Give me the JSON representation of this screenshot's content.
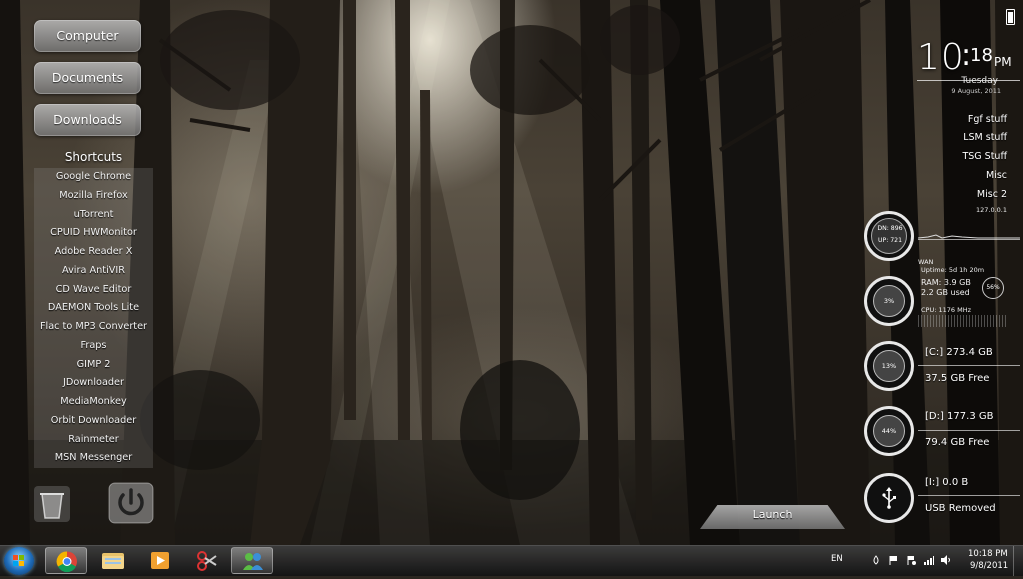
{
  "side_buttons": {
    "computer": "Computer",
    "documents": "Documents",
    "downloads": "Downloads"
  },
  "shortcuts": {
    "title": "Shortcuts",
    "items": [
      "Google Chrome",
      "Mozilla Firefox",
      "uTorrent",
      "CPUID HWMonitor",
      "Adobe Reader X",
      "Avira AntiVIR",
      "CD Wave Editor",
      "DAEMON Tools Lite",
      "Flac to MP3 Converter",
      "Fraps",
      "GIMP 2",
      "JDownloader",
      "MediaMonkey",
      "Orbit Downloader",
      "Rainmeter",
      "MSN Messenger"
    ]
  },
  "clock": {
    "hour": "10",
    "colon": ":",
    "minute": "18",
    "ampm": "PM",
    "day": "Tuesday",
    "date": "9 August, 2011"
  },
  "folders": [
    "Fgf stuff",
    "LSM stuff",
    "TSG Stuff",
    "Misc",
    "Misc 2"
  ],
  "network": {
    "ip": "127.0.0.1",
    "down": "DN: 896",
    "up": "UP: 721",
    "wan": "WAN"
  },
  "system": {
    "uptime": "Uptime:  5d  1h  20m",
    "ram": "RAM: 3.9 GB",
    "ram_used": "2.2 GB used",
    "ram_percent": "56%",
    "cpu_percent": "3%",
    "cpu_label": "CPU: 1176 MHz"
  },
  "drives": {
    "c_label": "[C:] 273.4 GB",
    "c_free": "37.5 GB Free",
    "c_percent": "13%",
    "d_label": "[D:] 177.3 GB",
    "d_free": "79.4 GB Free",
    "d_percent": "44%",
    "i_label": "[I:] 0.0 B",
    "i_status": "USB Removed"
  },
  "launch": "Launch",
  "taskbar": {
    "language": "EN",
    "time": "10:18 PM",
    "date": "9/8/2011"
  },
  "colors": {
    "sepia_dark": "#2b2620",
    "panel_gray": "#9a9a9a",
    "start_blue": "#1e6bb8"
  }
}
